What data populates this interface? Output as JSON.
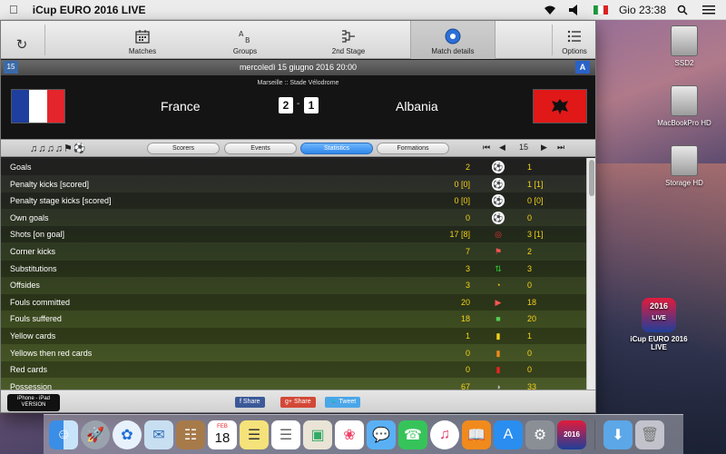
{
  "menubar": {
    "app_name": "iCup EURO 2016 LIVE",
    "clock": "Gio 23:38"
  },
  "toolbar": {
    "items": [
      {
        "label": "Matches",
        "icon": "calendar-icon"
      },
      {
        "label": "Groups",
        "icon": "groups-icon"
      },
      {
        "label": "2nd Stage",
        "icon": "bracket-icon"
      },
      {
        "label": "Match details",
        "icon": "ball-icon"
      },
      {
        "label": "Options",
        "icon": "list-icon"
      }
    ]
  },
  "datebar": {
    "day_badge": "15",
    "date": "mercoledì 15 giugno 2016 20:00",
    "group_badge": "A"
  },
  "match": {
    "venue": "Marseille :: Stade Vélodrome",
    "home_team": "France",
    "away_team": "Albania",
    "home_score": "2",
    "score_separator": "-",
    "away_score": "1"
  },
  "tabs": {
    "items": [
      "Scorers",
      "Events",
      "Statistics",
      "Formations"
    ],
    "active": "Statistics",
    "page_number": "15"
  },
  "stats": [
    {
      "label": "Goals",
      "home": "2",
      "away": "1",
      "icon": "ball-icon"
    },
    {
      "label": "Penalty kicks [scored]",
      "home": "0 [0]",
      "away": "1 [1]",
      "icon": "penalty-ball-icon"
    },
    {
      "label": "Penalty stage kicks [scored]",
      "home": "0 [0]",
      "away": "0 [0]",
      "icon": "penalty-stage-icon"
    },
    {
      "label": "Own goals",
      "home": "0",
      "away": "0",
      "icon": "own-goal-icon"
    },
    {
      "label": "Shots [on goal]",
      "home": "17 [8]",
      "away": "3 [1]",
      "icon": "target-icon"
    },
    {
      "label": "Corner kicks",
      "home": "7",
      "away": "2",
      "icon": "corner-flag-icon"
    },
    {
      "label": "Substitutions",
      "home": "3",
      "away": "3",
      "icon": "substitution-icon"
    },
    {
      "label": "Offsides",
      "home": "3",
      "away": "0",
      "icon": "offside-icon"
    },
    {
      "label": "Fouls committed",
      "home": "20",
      "away": "18",
      "icon": "whistle-icon"
    },
    {
      "label": "Fouls suffered",
      "home": "18",
      "away": "20",
      "icon": "foul-suffered-icon"
    },
    {
      "label": "Yellow cards",
      "home": "1",
      "away": "1",
      "icon": "yellow-card-icon"
    },
    {
      "label": "Yellows then red cards",
      "home": "0",
      "away": "0",
      "icon": "yellow-red-card-icon"
    },
    {
      "label": "Red cards",
      "home": "0",
      "away": "0",
      "icon": "red-card-icon"
    },
    {
      "label": "Possession",
      "home": "67",
      "away": "33",
      "icon": "possession-icon"
    }
  ],
  "bottombar": {
    "iphone_line1": "iPhone - iPad",
    "iphone_line2": "VERSION",
    "share_facebook": "Share",
    "share_google": "Share",
    "tweet": "Tweet"
  },
  "desktop": {
    "icons": [
      {
        "label": "SSD2",
        "type": "drive"
      },
      {
        "label": "MacBookPro HD",
        "type": "drive"
      },
      {
        "label": "Storage HD",
        "type": "drive"
      },
      {
        "label": "iCup EURO 2016 LIVE",
        "type": "app"
      }
    ],
    "app_icon_text": "2016",
    "app_icon_subtext": "LIVE"
  },
  "dock": {
    "calendar_month": "FEB",
    "calendar_day": "18",
    "items": [
      "finder-icon",
      "launchpad-icon",
      "safari-icon",
      "mail-icon",
      "contacts-icon",
      "calendar-icon",
      "notes-icon",
      "reminders-icon",
      "preview-icon",
      "photos-icon",
      "messages-icon",
      "facetime-icon",
      "music-icon",
      "books-icon",
      "app-store-icon",
      "system-preferences-icon",
      "icup-app-icon",
      "downloads-icon",
      "trash-icon"
    ]
  },
  "colors": {
    "stat_value": "#f5d21a",
    "active_tab": "#2f86e8",
    "flag_red": "#e01818"
  }
}
